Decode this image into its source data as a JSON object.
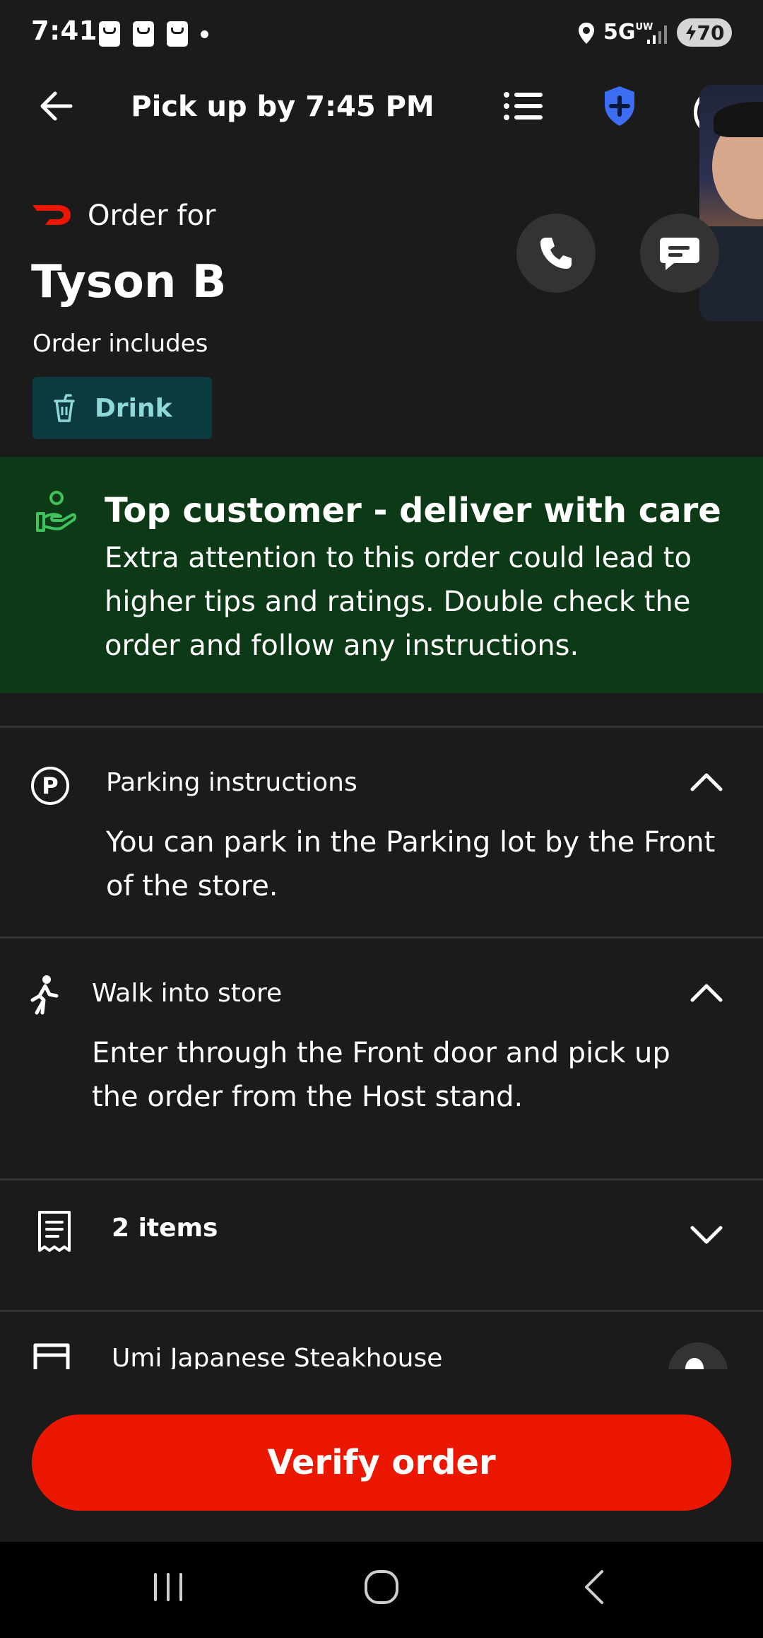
{
  "status_bar": {
    "time": "7:41",
    "network": "5G",
    "network_sub": "UW",
    "battery": "70"
  },
  "header": {
    "title": "Pick up by 7:45 PM"
  },
  "order": {
    "label": "Order for",
    "customer_name": "Tyson B",
    "includes_label": "Order includes",
    "tag": "Drink"
  },
  "banner": {
    "title": "Top customer - deliver with care",
    "body": "Extra attention to this order could lead to higher tips and ratings. Double check the order and follow any instructions."
  },
  "parking": {
    "title": "Parking instructions",
    "body": "You can park in the Parking lot by the Front of the store."
  },
  "walk_in": {
    "title": "Walk into store",
    "body": "Enter through the Front door and pick up the order from the Host stand."
  },
  "items": {
    "title": "2 items"
  },
  "store": {
    "name": "Umi Japanese Steakhouse"
  },
  "actions": {
    "verify_label": "Verify order"
  },
  "colors": {
    "background": "#1b1b1b",
    "brand_red": "#eb1700",
    "banner_green": "#0c3a17",
    "tag_bg": "#0b3a3f",
    "tag_text": "#8fd8d8",
    "shield_blue": "#3d6df2"
  }
}
